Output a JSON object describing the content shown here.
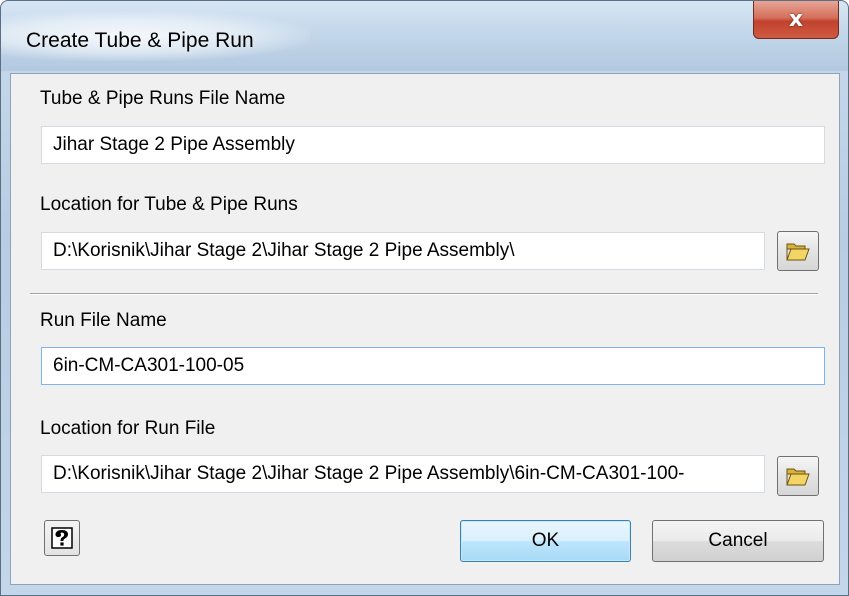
{
  "window": {
    "title": "Create Tube & Pipe Run",
    "close_symbol": "x"
  },
  "form": {
    "runs_file_name_label": "Tube & Pipe Runs File Name",
    "runs_file_name_value": "Jihar Stage 2 Pipe Assembly",
    "runs_location_label": "Location for Tube & Pipe Runs",
    "runs_location_value": "D:\\Korisnik\\Jihar Stage 2\\Jihar Stage 2 Pipe Assembly\\",
    "run_file_name_label": "Run File Name",
    "run_file_name_value": "6in-CM-CA301-100-05",
    "run_location_label": "Location for Run File",
    "run_location_value": "D:\\Korisnik\\Jihar Stage 2\\Jihar Stage 2 Pipe Assembly\\6in-CM-CA301-100-"
  },
  "buttons": {
    "ok_label": "OK",
    "cancel_label": "Cancel"
  },
  "icons": {
    "browse_icon": "folder-open-icon",
    "help_icon": "help-question-icon",
    "close_icon": "close-icon"
  },
  "colors": {
    "title_bar": "#c3d7ea",
    "close_button": "#c2422c",
    "client_background": "#f0f0f0",
    "default_button": "#bee6fd"
  }
}
